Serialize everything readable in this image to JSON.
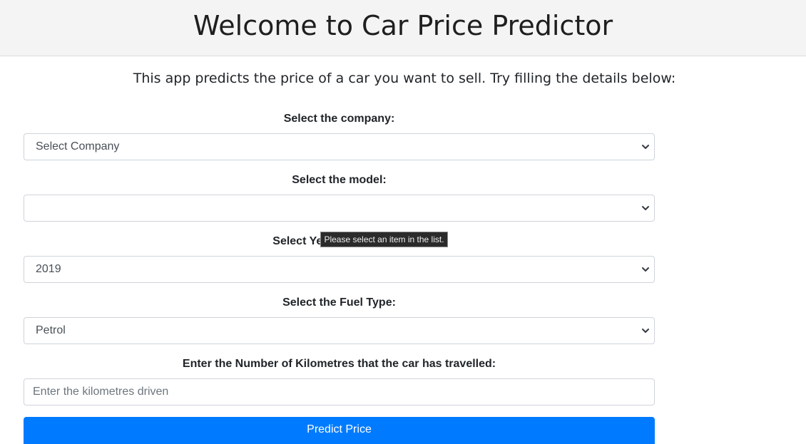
{
  "header": {
    "title": "Welcome to Car Price Predictor"
  },
  "subtitle": "This app predicts the price of a car you want to sell. Try filling the details below:",
  "form": {
    "company": {
      "label": "Select the company:",
      "value": "Select Company"
    },
    "model": {
      "label": "Select the model:",
      "value": ""
    },
    "year": {
      "label": "Select Year of Purchase:",
      "label_visible": "Select Ye",
      "value": "2019"
    },
    "fuel": {
      "label": "Select the Fuel Type:",
      "value": "Petrol"
    },
    "kms": {
      "label": "Enter the Number of Kilometres that the car has travelled:",
      "placeholder": "Enter the kilometres driven"
    },
    "submit_label": "Predict Price"
  },
  "tooltip": "Please select an item in the list."
}
